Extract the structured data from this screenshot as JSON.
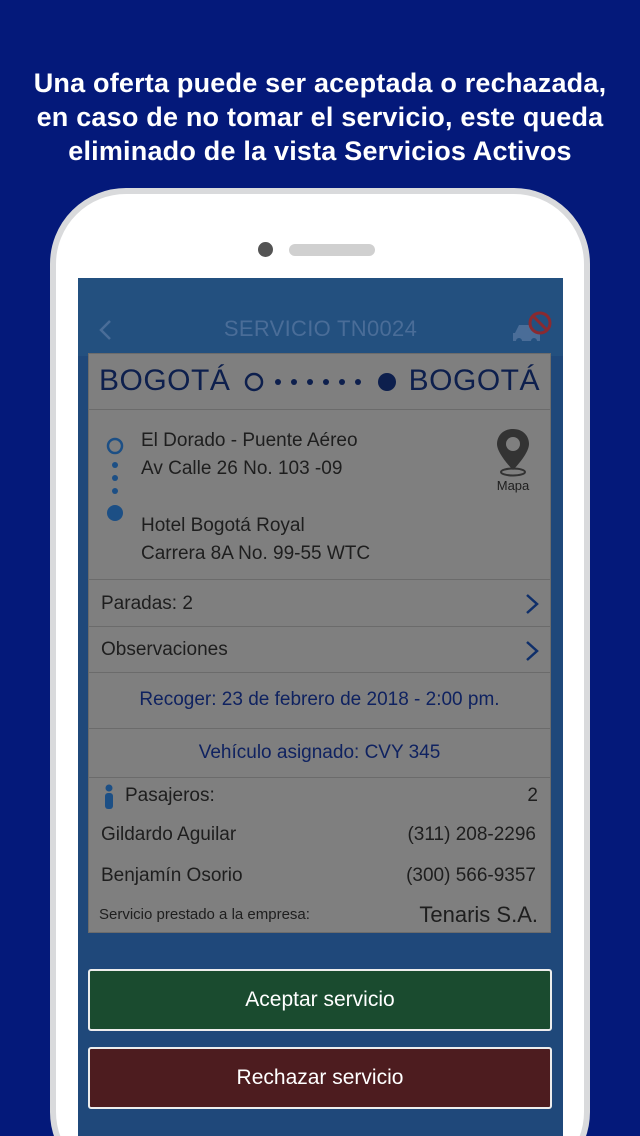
{
  "promo": {
    "line1": "Una oferta puede ser aceptada o rechazada,",
    "line2": "en caso de no tomar el servicio, este queda",
    "line3": "eliminado de la vista Servicios Activos"
  },
  "appbar": {
    "title": "SERVICIO TN0024",
    "back_icon": "chevron-left-icon",
    "action_icon": "car-cancel-icon"
  },
  "route": {
    "origin_city": "BOGOTÁ",
    "destination_city": "BOGOTÁ"
  },
  "addresses": {
    "pickup_name": "El Dorado - Puente Aéreo",
    "pickup_address": "Av Calle 26 No. 103 -09",
    "dropoff_name": "Hotel Bogotá Royal",
    "dropoff_address": "Carrera 8A No. 99-55 WTC",
    "map_label": "Mapa"
  },
  "stops": {
    "label": "Paradas: 2"
  },
  "notes": {
    "label": "Observaciones"
  },
  "pickup": {
    "text": "Recoger: 23 de febrero de 2018 - 2:00 pm."
  },
  "vehicle": {
    "text": "Vehículo asignado: CVY 345"
  },
  "passengers": {
    "label": "Pasajeros:",
    "count": "2",
    "list": [
      {
        "name": "Gildardo Aguilar",
        "phone": "(311) 208-2296"
      },
      {
        "name": "Benjamín Osorio",
        "phone": "(300) 566-9357"
      }
    ]
  },
  "company": {
    "label": "Servicio prestado a la empresa:",
    "value": "Tenaris S.A."
  },
  "actions": {
    "accept": "Aceptar servicio",
    "reject": "Rechazar servicio"
  },
  "colors": {
    "background": "#04197a",
    "screen_overlay": "#1f487a",
    "card": "#7f7f7f",
    "accept": "#1a4b2f",
    "reject": "#4d1c1f",
    "accent_text": "#0f2260"
  }
}
